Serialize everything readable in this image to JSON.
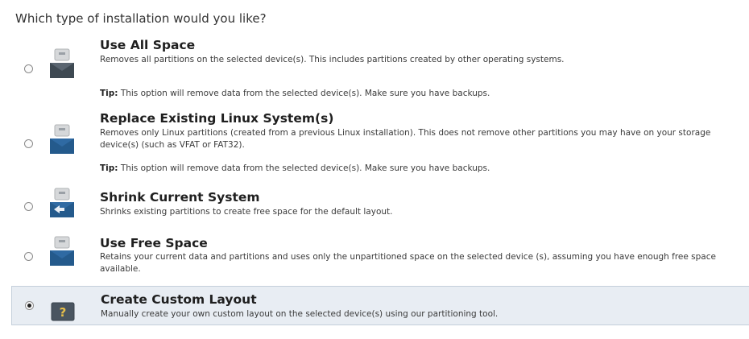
{
  "prompt": "Which type of installation would you like?",
  "options": [
    {
      "title": "Use All Space",
      "description": "Removes all partitions on the selected device(s).  This includes partitions created by other operating systems.",
      "tip_label": "Tip:",
      "tip_text": " This option will remove data from the selected device(s).  Make sure you have backups.",
      "icon": "disk-drive-icon",
      "selected": false
    },
    {
      "title": "Replace Existing Linux System(s)",
      "description": "Removes only Linux partitions (created from a previous Linux installation).  This does not remove other partitions you may have on your storage device(s) (such as VFAT or FAT32).",
      "tip_label": "Tip:",
      "tip_text": " This option will remove data from the selected device(s).  Make sure you have backups.",
      "icon": "disk-drive-icon",
      "selected": false
    },
    {
      "title": "Shrink Current System",
      "description": "Shrinks existing partitions to create free space for the default layout.",
      "icon": "shrink-disk-icon",
      "selected": false
    },
    {
      "title": "Use Free Space",
      "description": "Retains your current data and partitions and uses only the unpartitioned space on the selected device (s), assuming you have enough free space available.",
      "icon": "disk-drive-icon",
      "selected": false
    },
    {
      "title": "Create Custom Layout",
      "description": "Manually create your own custom layout on the selected device(s) using our partitioning tool.",
      "icon": "question-mark-icon",
      "selected": true
    }
  ],
  "colors": {
    "selected_background": "#e8edf3",
    "icon_blue": "#2f6aa3"
  }
}
